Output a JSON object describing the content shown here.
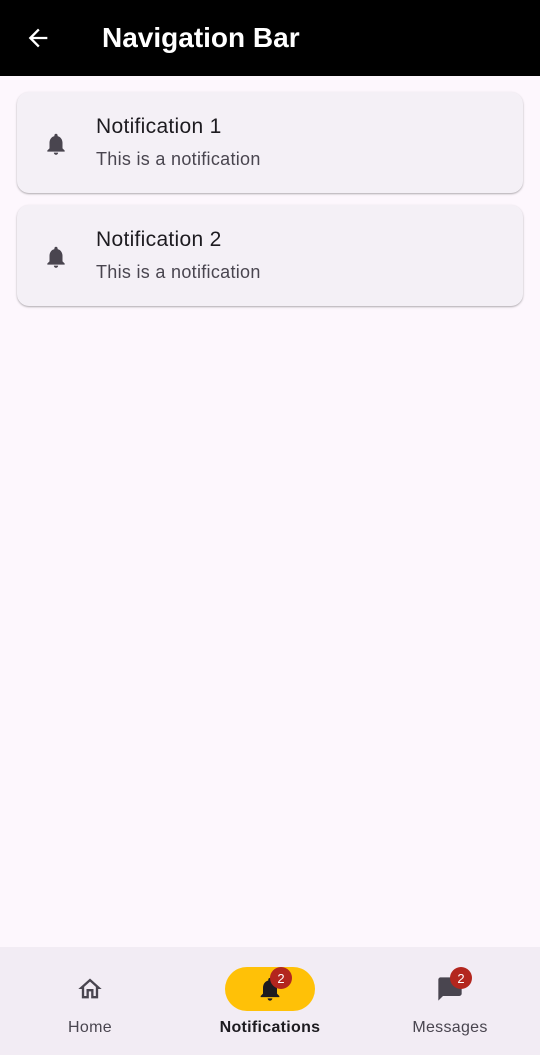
{
  "appbar": {
    "title": "Navigation Bar",
    "back_icon": "arrow-back-icon",
    "background": "#000000"
  },
  "notifications": [
    {
      "title": "Notification 1",
      "subtitle": "This is a notification",
      "icon": "bell-icon"
    },
    {
      "title": "Notification 2",
      "subtitle": "This is a notification",
      "icon": "bell-icon"
    }
  ],
  "bottom_nav": {
    "items": [
      {
        "label": "Home",
        "icon": "home-icon",
        "badge": null,
        "selected": false
      },
      {
        "label": "Notifications",
        "icon": "bell-icon",
        "badge": "2",
        "selected": true
      },
      {
        "label": "Messages",
        "icon": "message-icon",
        "badge": "2",
        "selected": false
      }
    ],
    "indicator_color": "#ffc107",
    "badge_color": "#b3261e"
  }
}
